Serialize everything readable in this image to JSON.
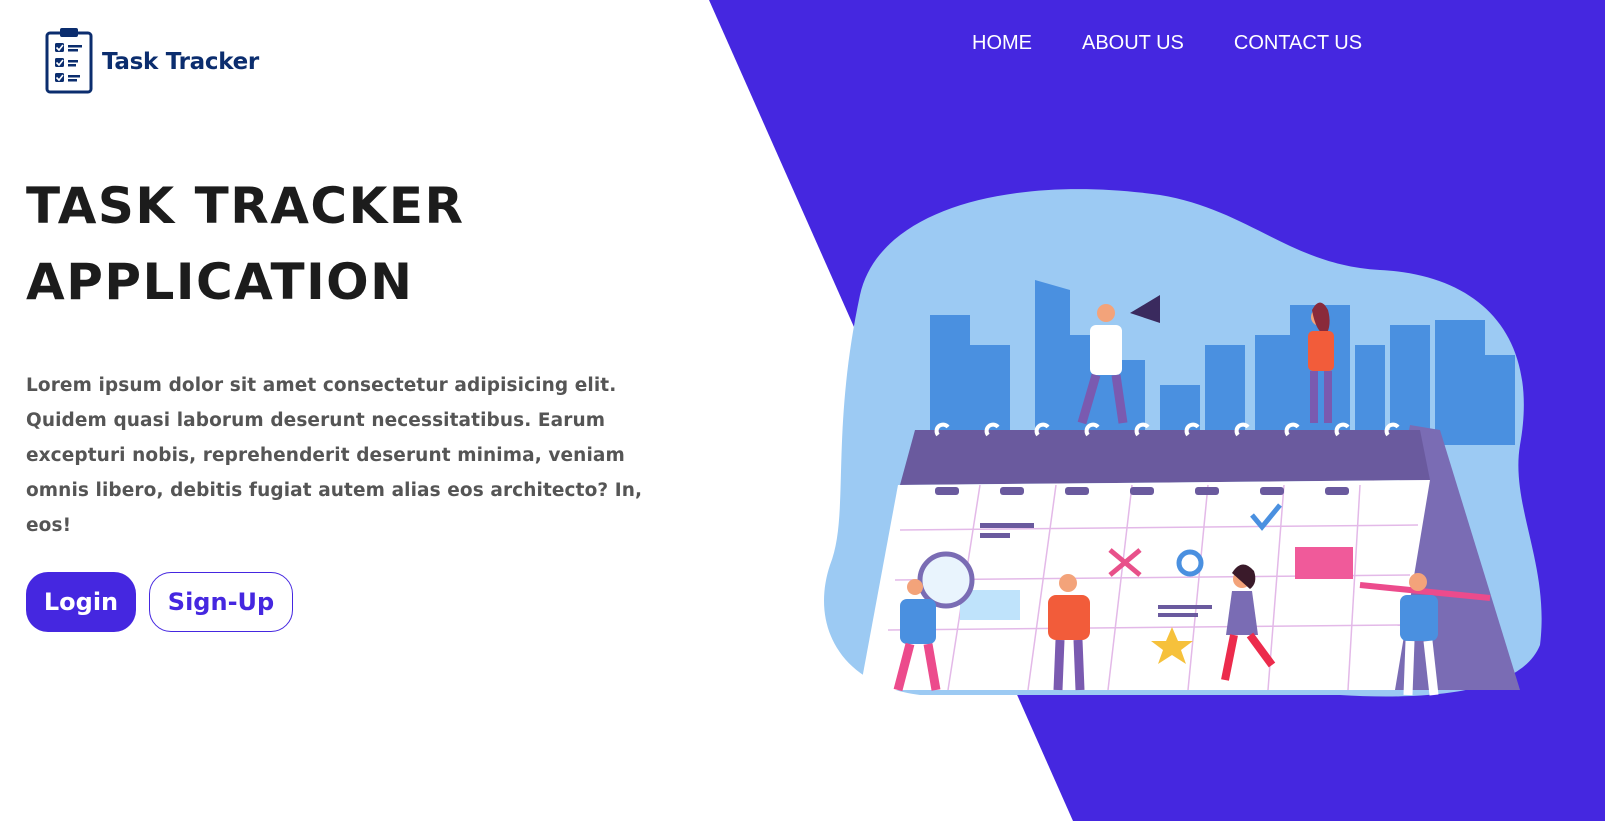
{
  "brand": {
    "name": "Task Tracker",
    "icon": "clipboard-checklist-icon"
  },
  "nav": {
    "items": [
      {
        "label": "HOME"
      },
      {
        "label": "ABOUT US"
      },
      {
        "label": "CONTACT US"
      }
    ]
  },
  "hero": {
    "title_line1": "TASK TRACKER",
    "title_line2": "APPLICATION",
    "description": "Lorem ipsum dolor sit amet consectetur adipisicing elit. Quidem quasi laborum deserunt necessitatibus. Earum excepturi nobis, reprehenderit deserunt minima, veniam omnis libero, debitis fugiat autem alias eos architecto? In, eos!",
    "login_label": "Login",
    "signup_label": "Sign-Up"
  },
  "colors": {
    "accent": "#4527e0",
    "brand_text": "#0b2d6e",
    "heading": "#1c1c1c",
    "body_text": "#555555"
  }
}
